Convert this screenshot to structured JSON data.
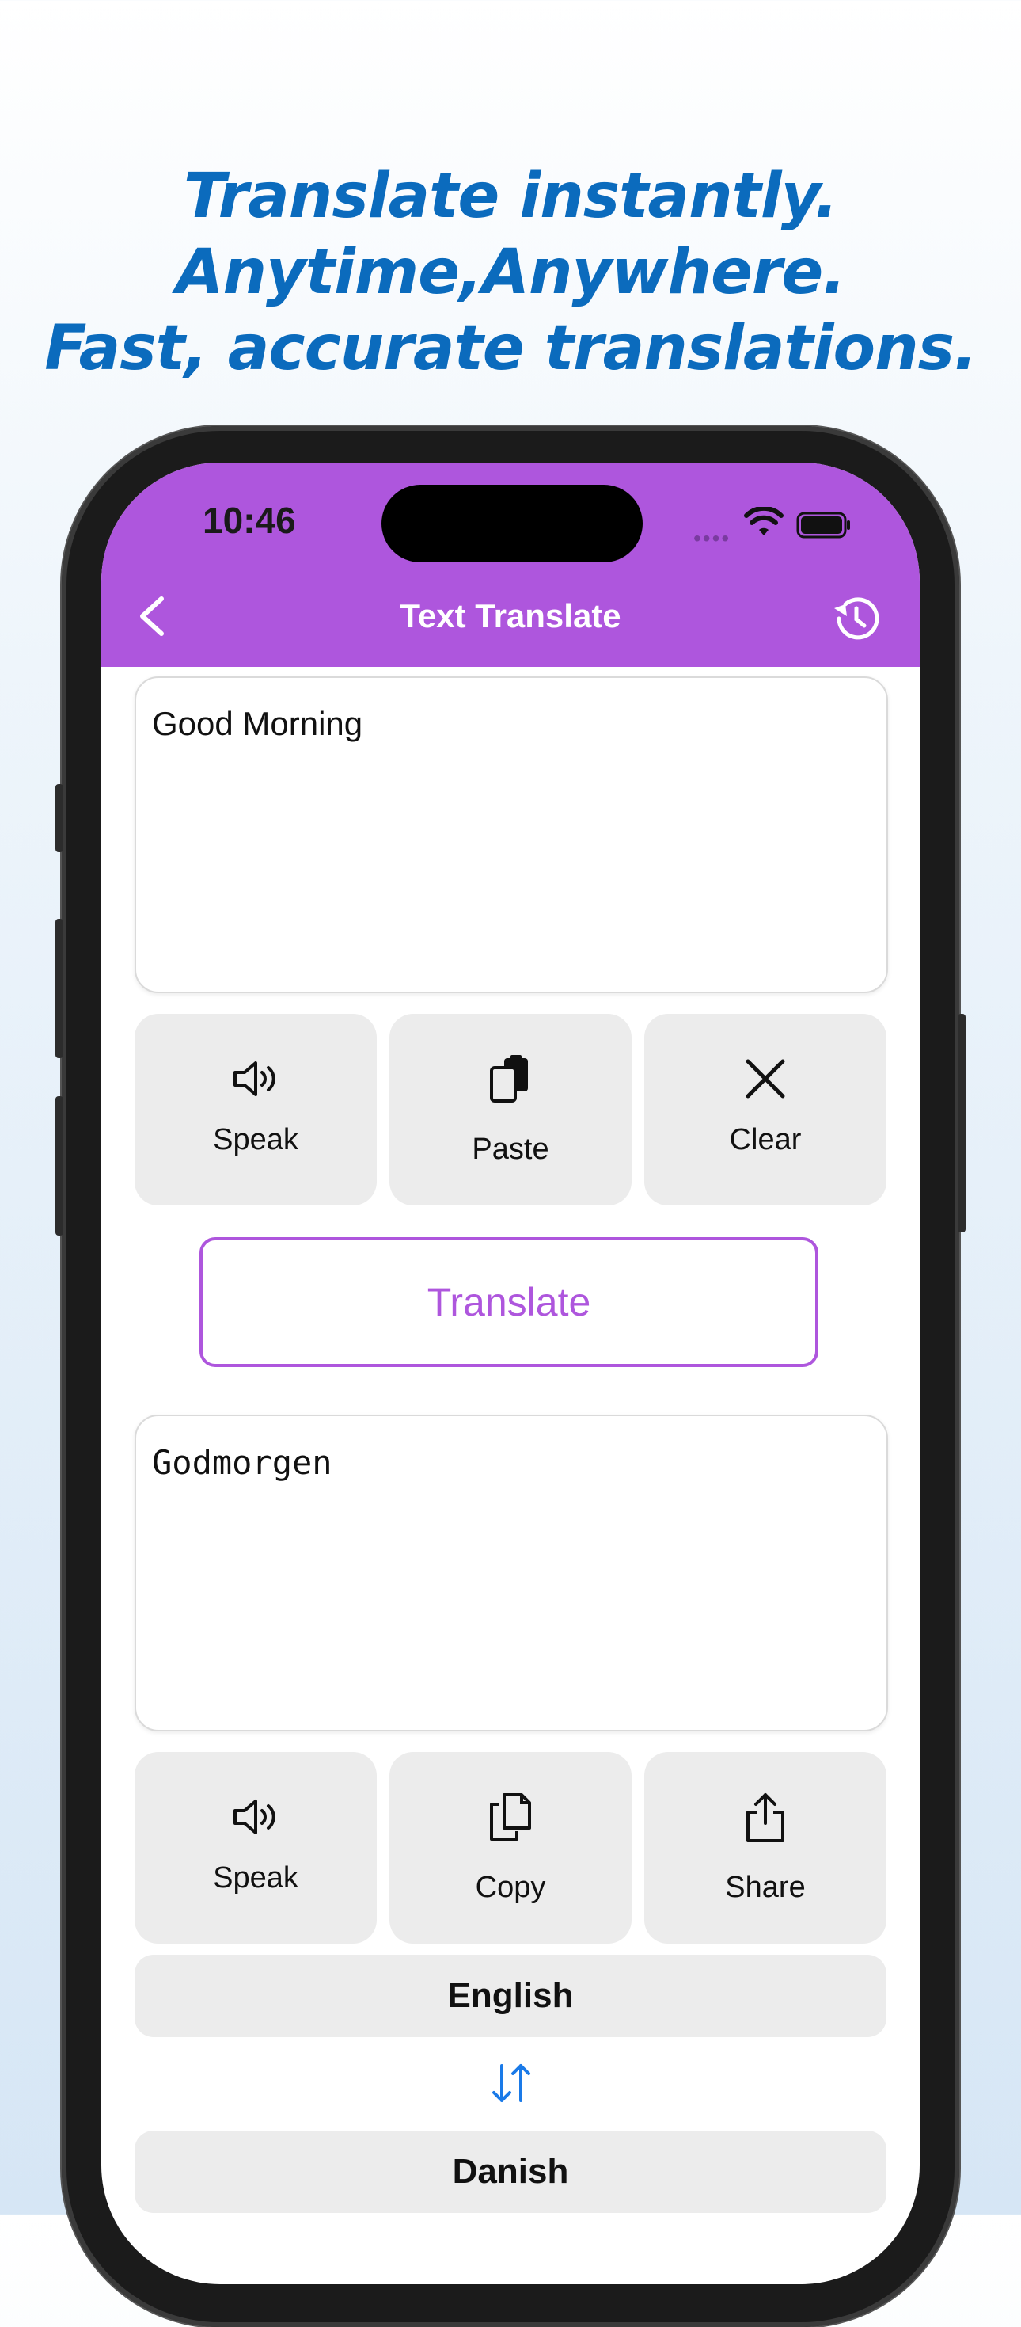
{
  "headline": {
    "line1": "Translate instantly.",
    "line2": "Anytime,Anywhere.",
    "line3": "Fast, accurate translations."
  },
  "status_bar": {
    "time": "10:46"
  },
  "nav": {
    "title": "Text Translate",
    "back_icon": "chevron-left-icon",
    "history_icon": "history-icon"
  },
  "source": {
    "text": "Good Morning",
    "actions": [
      {
        "label": "Speak",
        "icon": "speaker-icon"
      },
      {
        "label": "Paste",
        "icon": "paste-icon"
      },
      {
        "label": "Clear",
        "icon": "close-icon"
      }
    ]
  },
  "translate_label": "Translate",
  "result": {
    "text": "Godmorgen",
    "actions": [
      {
        "label": "Speak",
        "icon": "speaker-icon"
      },
      {
        "label": "Copy",
        "icon": "copy-icon"
      },
      {
        "label": "Share",
        "icon": "share-icon"
      }
    ]
  },
  "languages": {
    "from": "English",
    "to": "Danish",
    "swap_icon": "swap-icon"
  },
  "colors": {
    "accent": "#ae56dd",
    "headline": "#0b6bbd",
    "tile_bg": "#ececec",
    "swap": "#1a7ae8"
  }
}
